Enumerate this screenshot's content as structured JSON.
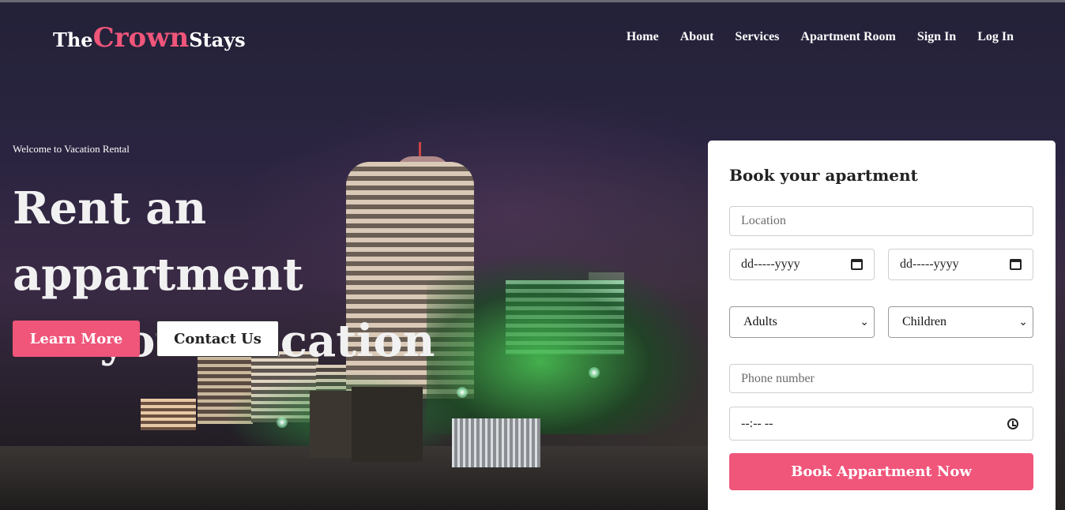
{
  "brand": {
    "prefix": "The",
    "main": "Crown",
    "suffix": "Stays",
    "accent_color": "#f0557a"
  },
  "nav": {
    "items": [
      {
        "label": "Home"
      },
      {
        "label": "About"
      },
      {
        "label": "Services"
      },
      {
        "label": "Apartment Room"
      },
      {
        "label": "Sign In"
      },
      {
        "label": "Log In"
      }
    ]
  },
  "hero": {
    "welcome": "Welcome to Vacation Rental",
    "headline_line1": "Rent an appartment",
    "headline_line2": "for your vacation",
    "learn_more_label": "Learn More",
    "contact_label": "Contact Us"
  },
  "booking": {
    "title": "Book your apartment",
    "location_placeholder": "Location",
    "checkin_value": "dd-----yyyy",
    "checkout_value": "dd-----yyyy",
    "adults_selected": "Adults",
    "children_selected": "Children",
    "phone_placeholder": "Phone number",
    "time_value": "--:-- --",
    "submit_label": "Book Appartment Now"
  },
  "icons": {
    "calendar": "calendar-icon",
    "chevron": "chevron-down-icon",
    "clock": "clock-icon"
  }
}
